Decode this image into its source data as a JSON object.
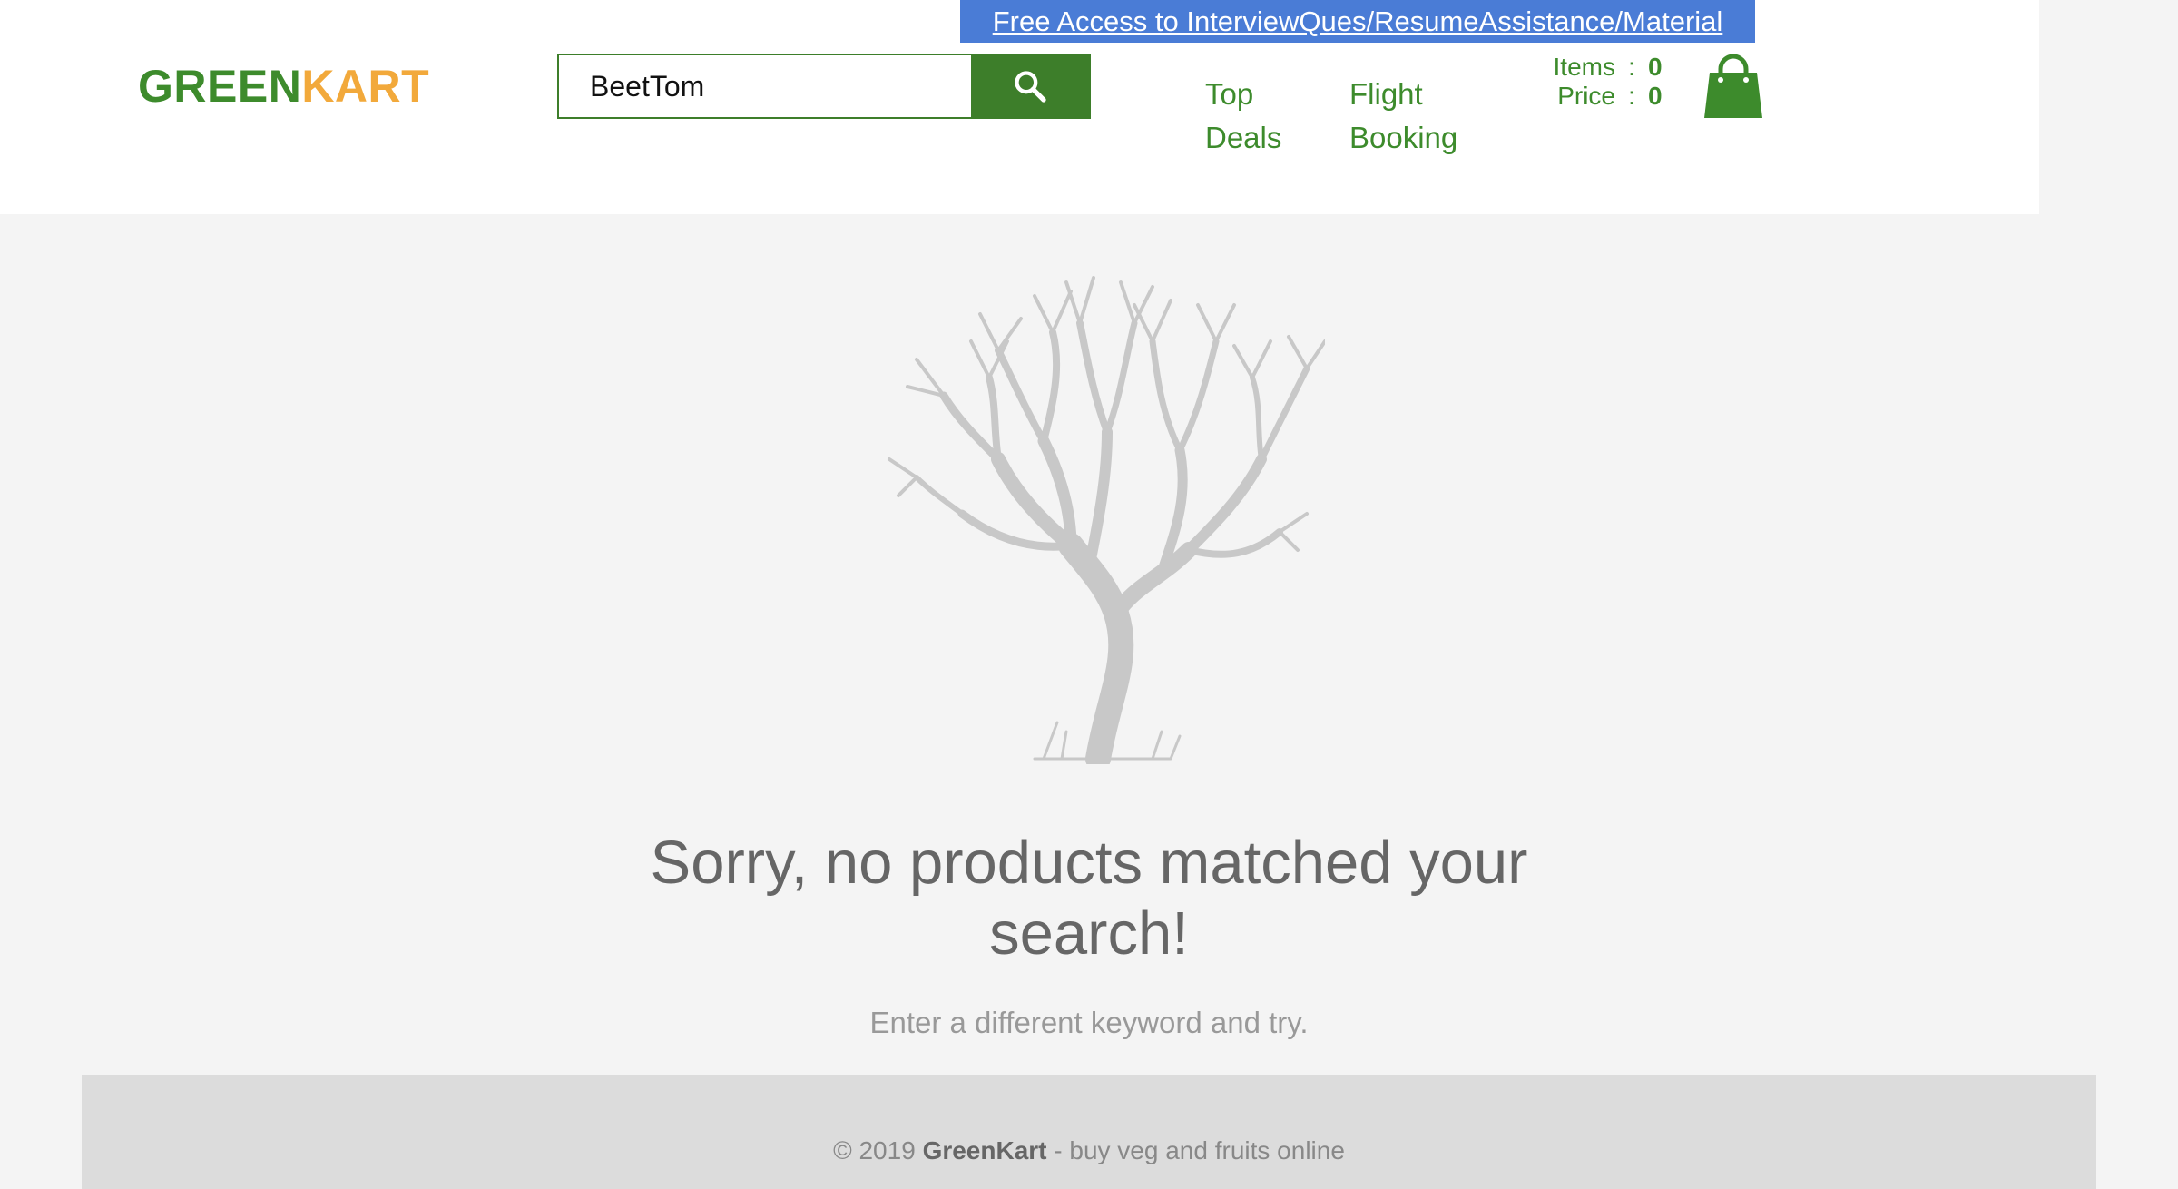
{
  "promo": {
    "text": "Free Access to InterviewQues/ResumeAssistance/Material"
  },
  "brand": {
    "part1": "GREEN",
    "part2": "KART"
  },
  "search": {
    "value": "BeetTom",
    "button_icon": "search-icon"
  },
  "nav": [
    {
      "line1": "Top",
      "line2": "Deals"
    },
    {
      "line1": "Flight",
      "line2": "Booking"
    }
  ],
  "cart": {
    "items_label": "Items",
    "items_value": "0",
    "price_label": "Price",
    "price_value": "0",
    "separator": ":",
    "icon": "shopping-bag-icon"
  },
  "empty": {
    "title": "Sorry, no products matched your search!",
    "subtitle": "Enter a different keyword and try.",
    "illustration": "bare-tree-icon"
  },
  "footer": {
    "prefix": "© 2019",
    "brand": "GreenKart",
    "suffix": "- buy veg and fruits online"
  },
  "colors": {
    "brand_green": "#3d8b2c",
    "brand_orange": "#f2a93b",
    "promo_blue": "#4a7cd6",
    "button_green": "#3d7e2a"
  }
}
